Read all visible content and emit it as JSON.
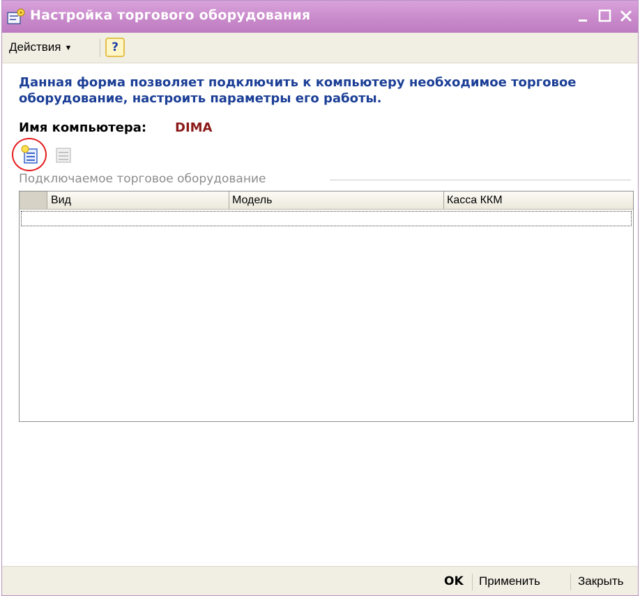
{
  "window": {
    "title": "Настройка торгового оборудования",
    "accent_color": "#c98acb",
    "icons": {
      "app": "form-gear-icon",
      "minimize": "minimize-icon",
      "maximize": "maximize-icon",
      "close": "close-icon"
    }
  },
  "menubar": {
    "actions_label": "Действия",
    "help_label": "?"
  },
  "form": {
    "description": "Данная форма позволяет подключить к компьютеру необходимое торговое оборудование, настроить параметры его работы.",
    "computer_label": "Имя компьютера:",
    "computer_name": "DIMA",
    "toolbar_icons": {
      "add": "add-row-icon",
      "remove": "remove-row-icon"
    }
  },
  "equipment_group": {
    "header": "Подключаемое торговое оборудование",
    "columns": [
      "Вид",
      "Модель",
      "Касса ККМ"
    ],
    "rows": []
  },
  "footer": {
    "ok_label": "OK",
    "apply_label": "Применить",
    "close_label": "Закрыть"
  }
}
